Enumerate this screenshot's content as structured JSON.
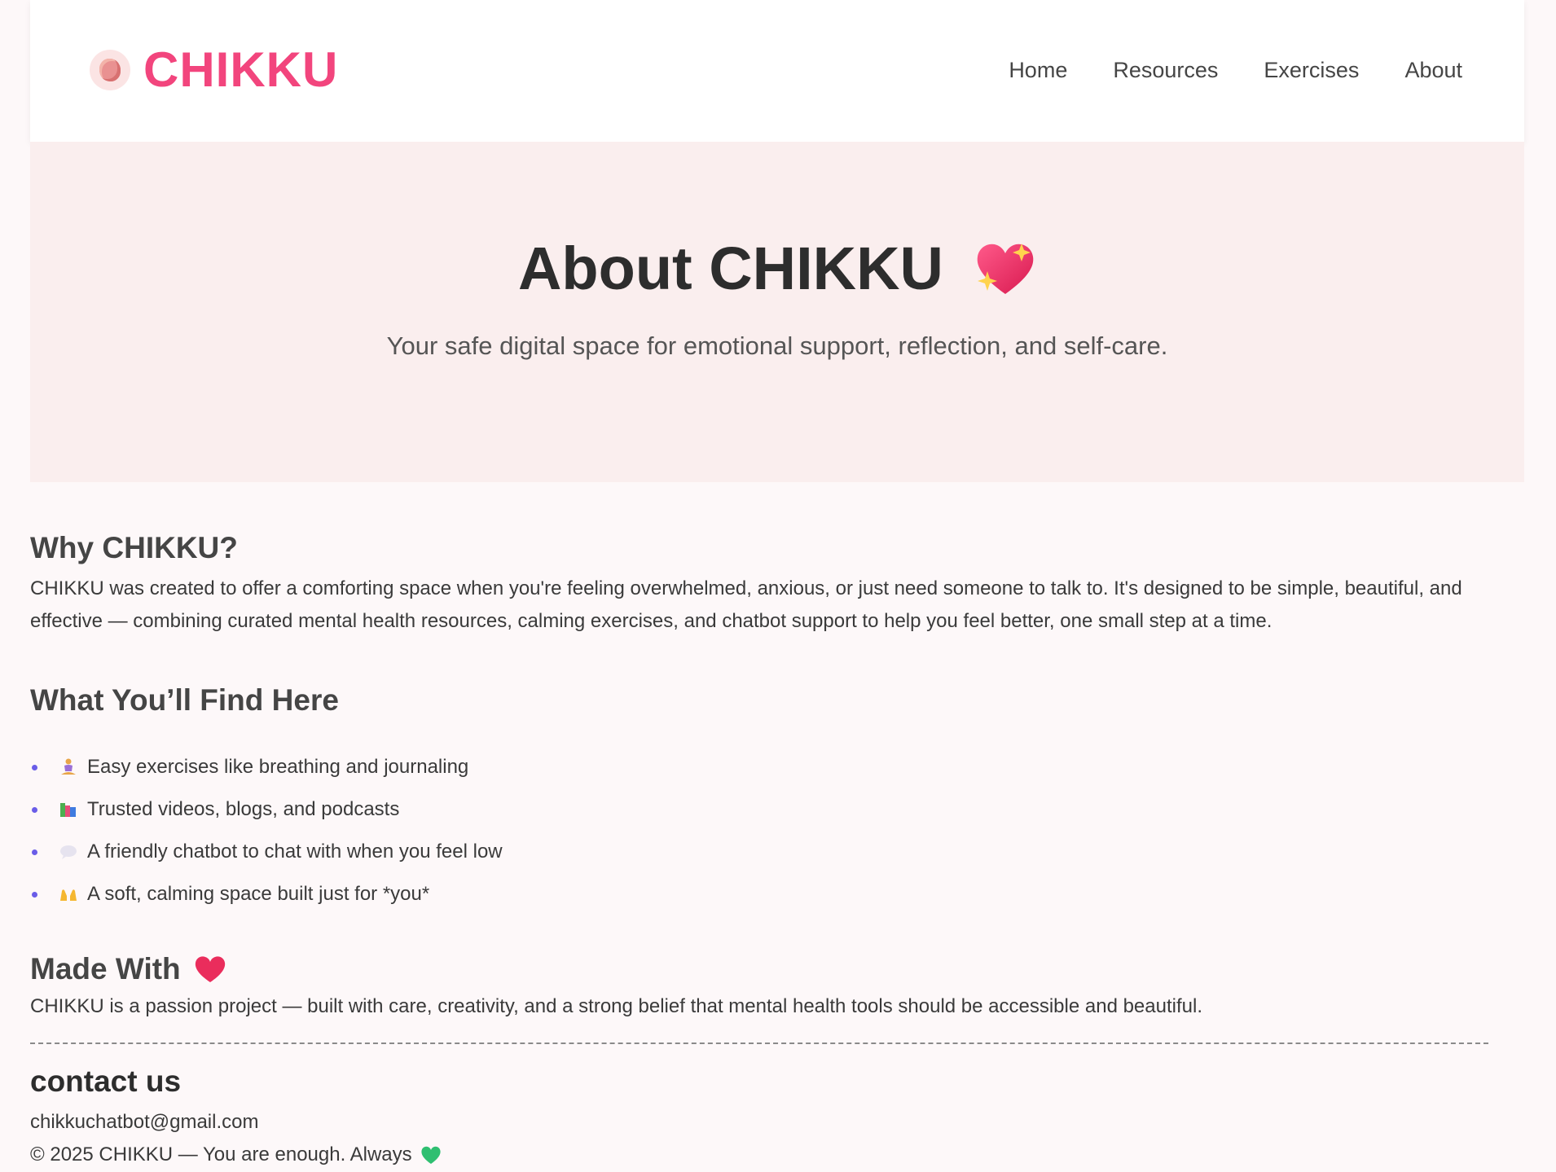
{
  "header": {
    "logo_icon": "brain-icon",
    "logo_text": "CHIKKU",
    "nav": [
      {
        "label": "Home"
      },
      {
        "label": "Resources"
      },
      {
        "label": "Exercises"
      },
      {
        "label": "About"
      }
    ]
  },
  "hero": {
    "title": "About CHIKKU",
    "title_icon": "sparkling-heart-icon",
    "subtitle": "Your safe digital space for emotional support, reflection, and self-care."
  },
  "why": {
    "title": "Why CHIKKU?",
    "body": "CHIKKU was created to offer a comforting space when you're feeling overwhelmed, anxious, or just need someone to talk to. It's designed to be simple, beautiful, and effective — combining curated mental health resources, calming exercises, and chatbot support to help you feel better, one small step at a time."
  },
  "features": {
    "title": "What You’ll Find Here",
    "items": [
      {
        "icon": "meditation-icon",
        "text": "Easy exercises like breathing and journaling"
      },
      {
        "icon": "books-icon",
        "text": "Trusted videos, blogs, and podcasts"
      },
      {
        "icon": "speech-bubble-icon",
        "text": "A friendly chatbot to chat with when you feel low"
      },
      {
        "icon": "raised-hands-icon",
        "text": "A soft, calming space built just for *you*"
      }
    ]
  },
  "made_with": {
    "title": "Made With",
    "title_icon": "heart-icon",
    "body": "CHIKKU is a passion project — built with care, creativity, and a strong belief that mental health tools should be accessible and beautiful."
  },
  "footer": {
    "contact_title": "contact us",
    "email": "chikkuchatbot@gmail.com",
    "copyright": "© 2025 CHIKKU — You are enough. Always",
    "copyright_icon": "green-heart-icon"
  },
  "colors": {
    "brand_pink": "#f2457d",
    "hero_bg": "#faeeee",
    "page_bg": "#fdf8f9",
    "bullet": "#6a5de8"
  }
}
